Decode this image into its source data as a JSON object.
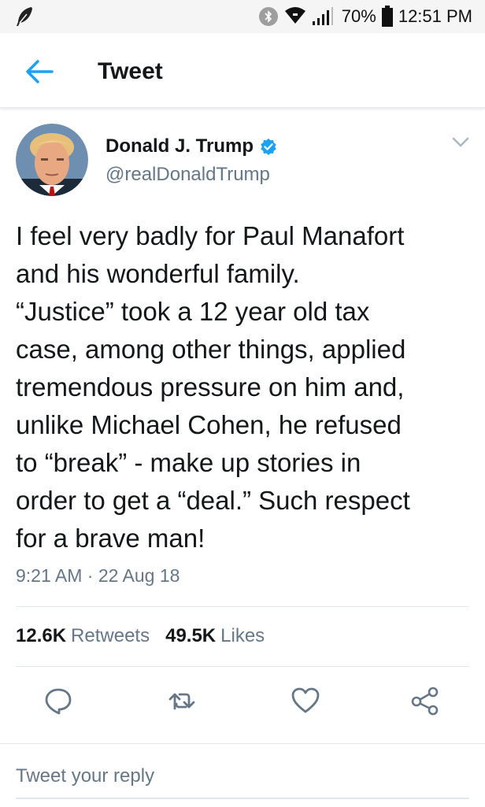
{
  "status_bar": {
    "battery_percent": "70%",
    "time": "12:51 PM"
  },
  "header": {
    "title": "Tweet"
  },
  "tweet": {
    "display_name": "Donald J. Trump",
    "handle": "@realDonaldTrump",
    "verified": true,
    "text": "I feel very badly for Paul Manafort\nand his wonderful family.\n“Justice” took a 12 year old tax\ncase, among other things, applied\ntremendous pressure on him and,\nunlike Michael Cohen, he refused\nto “break” - make up stories in\norder to get a “deal.” Such respect\nfor a brave man!",
    "timestamp": "9:21 AM · 22 Aug 18",
    "retweets_count": "12.6K",
    "retweets_label": "Retweets",
    "likes_count": "49.5K",
    "likes_label": "Likes"
  },
  "reply": {
    "placeholder": "Tweet your reply"
  },
  "colors": {
    "accent": "#1da1f2",
    "secondary_text": "#657786",
    "divider": "#e1e8ed"
  },
  "icons": {
    "status_left": "feather-icon",
    "bluetooth": "bluetooth-icon",
    "wifi": "wifi-icon",
    "signal": "signal-icon",
    "battery": "battery-icon",
    "back": "back-arrow-icon",
    "verified": "verified-badge-icon",
    "caret": "chevron-down-icon",
    "reply": "reply-icon",
    "retweet": "retweet-icon",
    "like": "heart-icon",
    "share": "share-icon"
  }
}
